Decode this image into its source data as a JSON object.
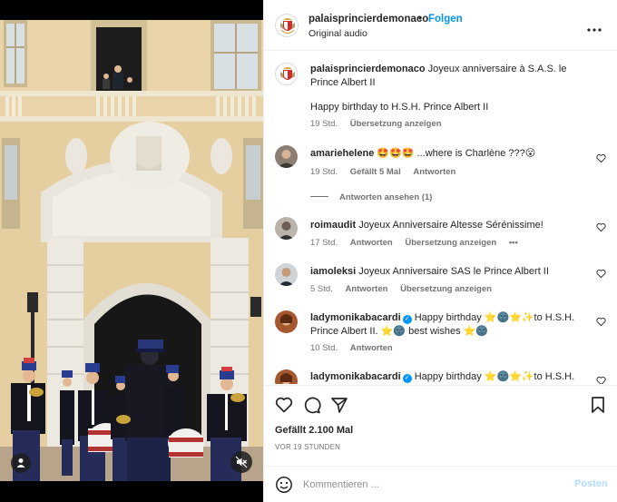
{
  "colors": {
    "accent": "#0095f6",
    "muted": "#737373",
    "text": "#262626",
    "disabled_post": "#b3dbff"
  },
  "header": {
    "username": "palaisprincierdemonaco",
    "separator": "•",
    "follow_label": "Folgen",
    "audio": "Original audio",
    "more_icon": "more-horizontal-icon"
  },
  "caption": {
    "username": "palaisprincierdemonaco",
    "text": "Joyeux anniversaire à S.A.S. le Prince Albert II",
    "text2": "Happy birthday to H.S.H. Prince Albert II",
    "time": "19 Std.",
    "translate": "Übersetzung anzeigen"
  },
  "comments": [
    {
      "username": "amariehelene",
      "text": "🤩🤩🤩 ...where is Charlène ???😮",
      "time": "19 Std.",
      "likes": "Gefällt 5 Mal",
      "reply": "Antworten",
      "view_replies": "Antworten ansehen (1)"
    },
    {
      "username": "roimaudit",
      "text": "Joyeux Anniversaire Altesse Sérénissime!",
      "time": "17 Std.",
      "reply": "Antworten",
      "translate": "Übersetzung anzeigen",
      "more": "•••"
    },
    {
      "username": "iamoleksi",
      "text": "Joyeux Anniversaire SAS le Prince Albert II",
      "time": "5 Std.",
      "reply": "Antworten",
      "translate": "Übersetzung anzeigen"
    },
    {
      "username": "ladymonikabacardi",
      "verified": "✓",
      "text": "Happy birthday ⭐🌚⭐✨to H.S.H. Prince Albert II. ⭐🌚 best wishes ⭐🌚",
      "time": "10 Std.",
      "reply": "Antworten"
    },
    {
      "username": "ladymonikabacardi",
      "verified": "✓",
      "text": "Happy birthday ⭐🌚⭐✨to H.S.H."
    }
  ],
  "actions": {
    "like_icon": "heart-icon",
    "comment_icon": "comment-icon",
    "share_icon": "send-icon",
    "save_icon": "bookmark-icon"
  },
  "likes": "Gefällt 2.100 Mal",
  "timestamp": "VOR 19 STUNDEN",
  "composer": {
    "placeholder": "Kommentieren ...",
    "post_label": "Posten"
  },
  "media": {
    "user_tag_icon": "person-icon",
    "mute_icon": "speaker-muted-icon"
  }
}
